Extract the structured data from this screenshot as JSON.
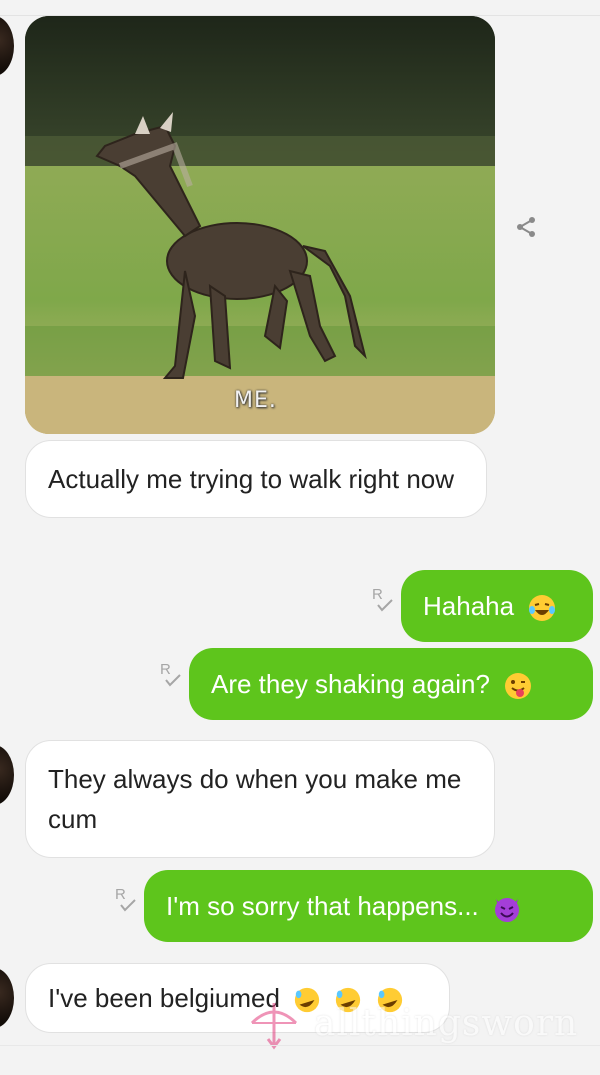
{
  "media": {
    "caption": "ME."
  },
  "messages": [
    {
      "text": "Actually me trying to walk right now"
    },
    {
      "text": "Hahaha",
      "receipt": "R"
    },
    {
      "text": "Are they shaking again?",
      "receipt": "R"
    },
    {
      "text": "They always do when you make me cum"
    },
    {
      "text": "I'm so sorry that happens...",
      "receipt": "R"
    },
    {
      "text": "I've been belgiumed"
    }
  ],
  "watermark": {
    "text": "allthingsworn"
  },
  "colors": {
    "outgoing": "#5ec51c",
    "incoming": "#ffffff",
    "background": "#f3f3f3"
  },
  "icons": [
    "share-icon",
    "read-receipt-icon",
    "laughing-tears-emoji",
    "winking-tongue-emoji",
    "smiling-devil-emoji",
    "rofl-emoji",
    "bow-and-arrow-logo"
  ]
}
